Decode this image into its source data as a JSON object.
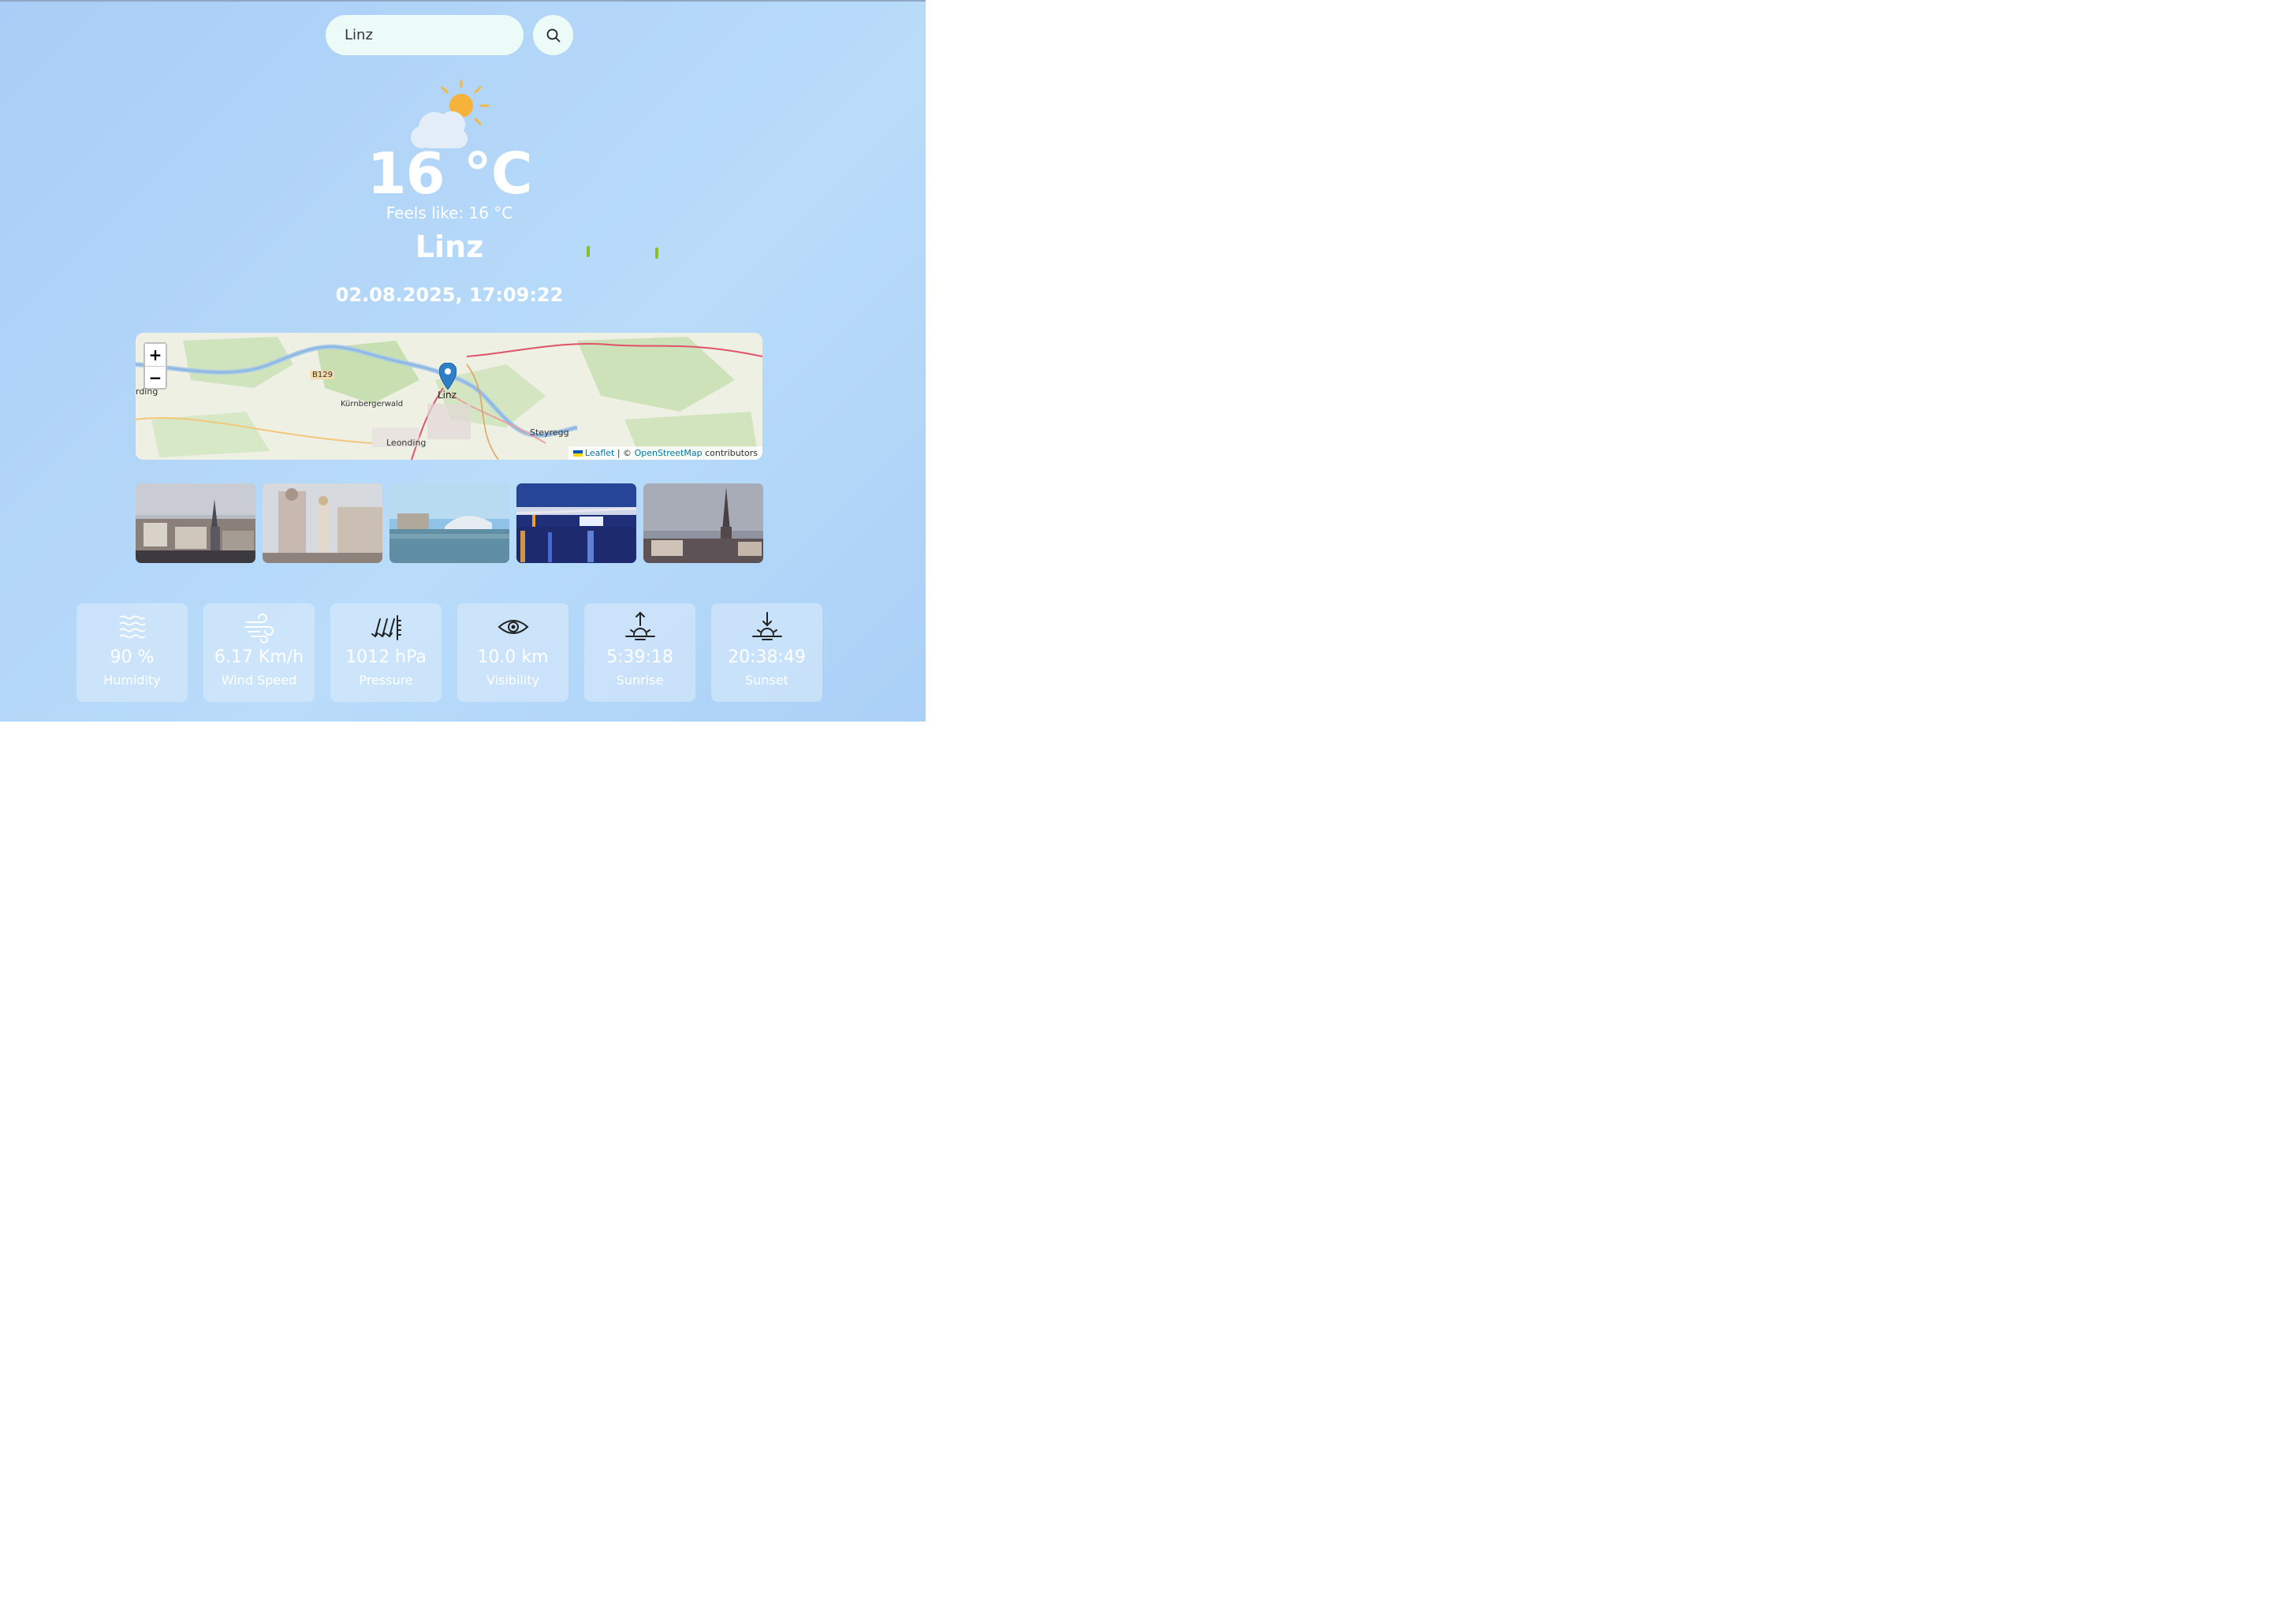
{
  "search": {
    "value": "Linz",
    "placeholder": ""
  },
  "current": {
    "icon": "sun-behind-cloud-icon",
    "temperature": "16 °C",
    "feels_like": "Feels like: 16 °C",
    "city": "Linz",
    "datetime": "02.08.2025, 17:09:22"
  },
  "map": {
    "zoom_in": "+",
    "zoom_out": "−",
    "marker_label": "Linz",
    "labels": [
      "rding",
      "B129",
      "Kürnbergerwald",
      "Leonding",
      "Steyregg"
    ],
    "attribution": {
      "leaflet": "Leaflet",
      "separator": "| ©",
      "osm": "OpenStreetMap",
      "suffix": "contributors"
    }
  },
  "photos": [
    "Linz skyline with cathedral",
    "Linz Trinity column square",
    "Linz Danube riverfront",
    "Linz bridge at night",
    "Linz cathedral spire"
  ],
  "stats": [
    {
      "icon": "humidity-waves-icon",
      "value": "90 %",
      "label": "Humidity"
    },
    {
      "icon": "wind-icon",
      "value": "6.17 Km/h",
      "label": "Wind Speed"
    },
    {
      "icon": "pressure-icon",
      "value": "1012 hPa",
      "label": "Pressure"
    },
    {
      "icon": "eye-icon",
      "value": "10.0 km",
      "label": "Visibility"
    },
    {
      "icon": "sunrise-icon",
      "value": "5:39:18",
      "label": "Sunrise"
    },
    {
      "icon": "sunset-icon",
      "value": "20:38:49",
      "label": "Sunset"
    }
  ],
  "colors": {
    "accent": "#3a8fd1",
    "background": "#b3d5f8",
    "card": "#dcecfc"
  }
}
